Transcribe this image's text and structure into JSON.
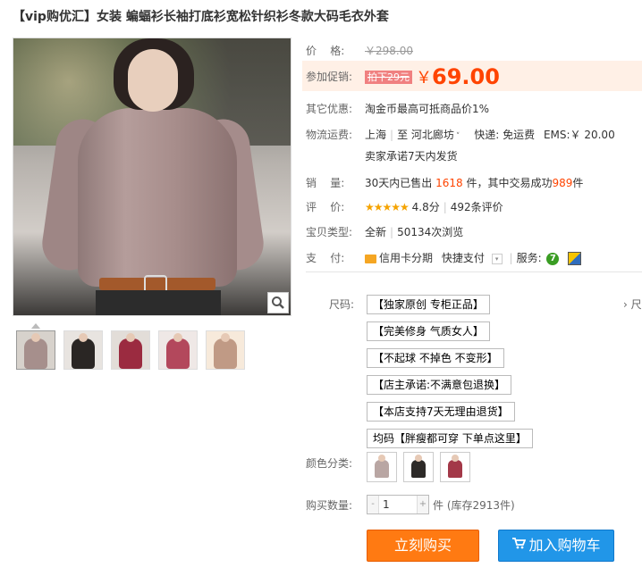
{
  "product": {
    "title": "【vip购优汇】女装 蝙蝠衫长袖打底衫宽松针织衫冬款大码毛衣外套"
  },
  "info": {
    "price_label": "价    格:",
    "original_price": "￥298.00",
    "promo_label": "参加促销:",
    "promo_tag": "拍下29元",
    "promo_currency": "￥",
    "promo_price": "69.00",
    "other_label": "其它优惠:",
    "other_text": "淘金币最高可抵商品价1%",
    "shipping_label": "物流运费:",
    "ship_from": "上海",
    "ship_to_prefix": "至",
    "ship_to": "河北廊坊",
    "express": "快递: 免运费",
    "ems": "EMS:￥ 20.00",
    "ship_promise": "卖家承诺7天内发货",
    "sales_label": "销    量:",
    "sales_prefix": "30天内已售出",
    "sales_count": "1618",
    "sales_mid": "件，其中交易成功",
    "sales_success": "989",
    "sales_suffix": "件",
    "rating_label": "评    价:",
    "rating_stars": "★★★★★",
    "rating_score": "4.8分",
    "rating_reviews": "492条评价",
    "type_label": "宝贝类型:",
    "type_value": "全新",
    "views": "50134次浏览",
    "pay_label": "支    付:",
    "pay_credit": "信用卡分期",
    "pay_quick": "快捷支付",
    "service_label": "服务:"
  },
  "size": {
    "label": "尺码:",
    "options": [
      "【独家原创 专柜正品】",
      "【完美修身 气质女人】",
      "【不起球 不掉色 不变形】",
      "【店主承诺:不满意包退换】",
      "【本店支持7天无理由退货】",
      "均码【胖瘦都可穿 下单点这里】"
    ],
    "more": "› 尺"
  },
  "color": {
    "label": "颜色分类:",
    "swatches": [
      "#b9a6a3",
      "#2d2a28",
      "#a33848"
    ]
  },
  "quantity": {
    "label": "购买数量:",
    "minus": "-",
    "value": "1",
    "plus": "+",
    "stock": "件 (库存2913件)"
  },
  "buttons": {
    "buy": "立刻购买",
    "cart": "加入购物车"
  },
  "colors": {
    "accent": "#ff4400",
    "buy_bg": "#ff7a12",
    "cart_bg": "#2196e8"
  }
}
